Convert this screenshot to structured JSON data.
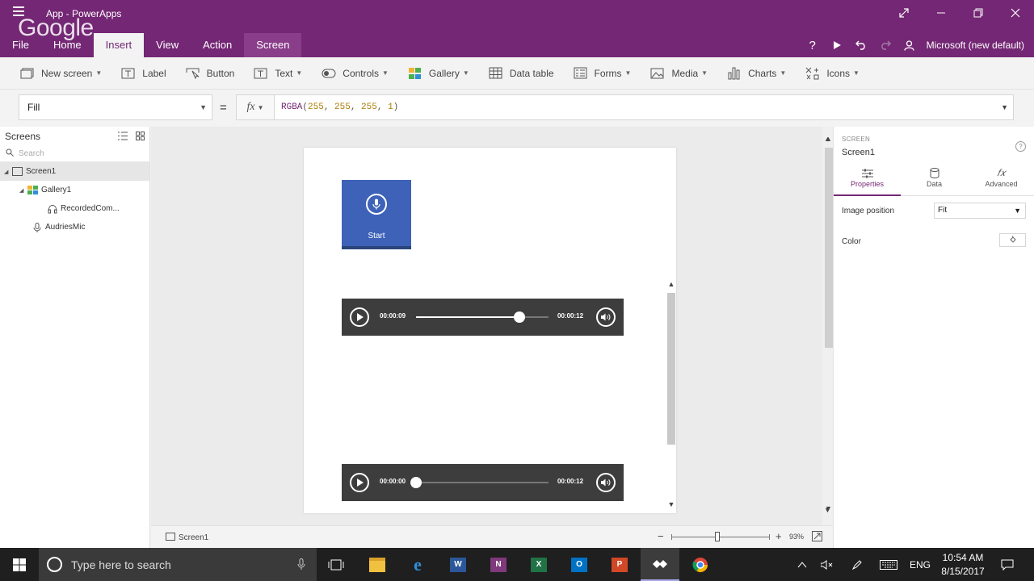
{
  "window": {
    "title": "App - PowerApps",
    "watermark": "Google",
    "account": "Microsoft (new default)"
  },
  "menu_tabs": [
    {
      "label": "File"
    },
    {
      "label": "Home"
    },
    {
      "label": "Insert"
    },
    {
      "label": "View"
    },
    {
      "label": "Action"
    },
    {
      "label": "Screen"
    }
  ],
  "ribbon": {
    "new_screen": "New screen",
    "label": "Label",
    "button": "Button",
    "text": "Text",
    "controls": "Controls",
    "gallery": "Gallery",
    "data_table": "Data table",
    "forms": "Forms",
    "media": "Media",
    "charts": "Charts",
    "icons": "Icons"
  },
  "formula": {
    "property": "Fill",
    "equals": "=",
    "fx": "fx",
    "fn": "RGBA",
    "args": [
      "255",
      "255",
      "255",
      "1"
    ]
  },
  "tree": {
    "header": "Screens",
    "search_placeholder": "Search",
    "items": [
      {
        "label": "Screen1"
      },
      {
        "label": "Gallery1"
      },
      {
        "label": "RecordedCom..."
      },
      {
        "label": "AudriesMic"
      }
    ]
  },
  "canvas": {
    "mic_label": "Start",
    "players": [
      {
        "start": "00:00:09",
        "end": "00:00:12",
        "progress": 0.78
      },
      {
        "start": "00:00:00",
        "end": "00:00:12",
        "progress": 0.0
      }
    ]
  },
  "status": {
    "screen": "Screen1",
    "minus": "−",
    "plus": "+",
    "zoom": "93%",
    "zoom_level": 0.47
  },
  "props": {
    "type": "SCREEN",
    "name": "Screen1",
    "help": "?",
    "tabs": [
      {
        "label": "Properties"
      },
      {
        "label": "Data"
      },
      {
        "label": "Advanced"
      }
    ],
    "image_position_label": "Image position",
    "image_position_value": "Fit",
    "color_label": "Color"
  },
  "taskbar": {
    "search_placeholder": "Type here to search",
    "lang": "ENG",
    "time": "10:54 AM",
    "date": "8/15/2017"
  },
  "colors": {
    "brand": "#742774",
    "mic_button": "#3d62b8",
    "player_bg": "#3d3d3d"
  }
}
